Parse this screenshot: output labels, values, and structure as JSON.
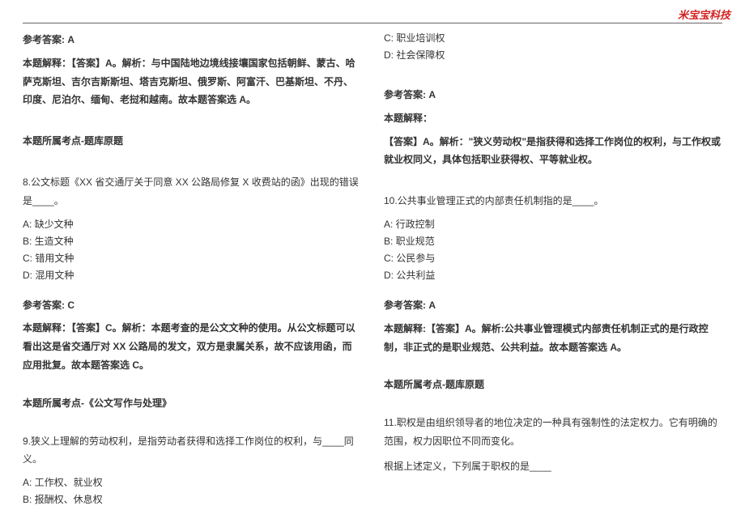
{
  "watermark": "米宝宝科技",
  "col_left": {
    "ans7_label": "参考答案: A",
    "exp7": "本题解释：【答案】A。解析：与中国陆地边境线接壤国家包括朝鲜、蒙古、哈萨克斯坦、吉尔吉斯斯坦、塔吉克斯坦、俄罗斯、阿富汗、巴基斯坦、不丹、印度、尼泊尔、缅甸、老挝和越南。故本题答案选 A。",
    "src7": "本题所属考点-题库原题",
    "q8": {
      "stem": "8.公文标题《XX 省交通厅关于同意 XX 公路局修复 X 收费站的函》出现的错误是____。",
      "A": "A: 缺少文种",
      "B": "B: 生造文种",
      "C": "C: 错用文种",
      "D": "D: 混用文种"
    },
    "ans8_label": "参考答案: C",
    "exp8": "本题解释：【答案】C。解析：本题考查的是公文文种的使用。从公文标题可以看出这是省交通厅对 XX 公路局的发文，双方是隶属关系，故不应该用函，而应用批复。故本题答案选 C。",
    "src8": "本题所属考点-《公文写作与处理》",
    "q9": {
      "stem": "9.狭义上理解的劳动权利，是指劳动者获得和选择工作岗位的权利，与____同义。",
      "A": "A: 工作权、就业权",
      "B": "B: 报酬权、休息权",
      "C": "C: 职业培训权"
    }
  },
  "col_right": {
    "q9D": "D: 社会保障权",
    "ans9_label": "参考答案: A",
    "exp9_head": "本题解释：",
    "exp9_body": "【答案】A。解析：\"狭义劳动权\"是指获得和选择工作岗位的权利，与工作权或就业权同义，具体包括职业获得权、平等就业权。",
    "q10": {
      "stem": "10.公共事业管理正式的内部责任机制指的是____。",
      "A": "A: 行政控制",
      "B": "B: 职业规范",
      "C": "C: 公民参与",
      "D": "D: 公共利益"
    },
    "ans10_label": "参考答案: A",
    "exp10": "本题解释:【答案】A。解析:公共事业管理模式内部责任机制正式的是行政控制，非正式的是职业规范、公共利益。故本题答案选 A。",
    "src10": "本题所属考点-题库原题",
    "q11": {
      "stem": "11.职权是由组织领导者的地位决定的一种具有强制性的法定权力。它有明确的范围，权力因职位不同而变化。",
      "sub": "根据上述定义，下列属于职权的是____"
    }
  }
}
